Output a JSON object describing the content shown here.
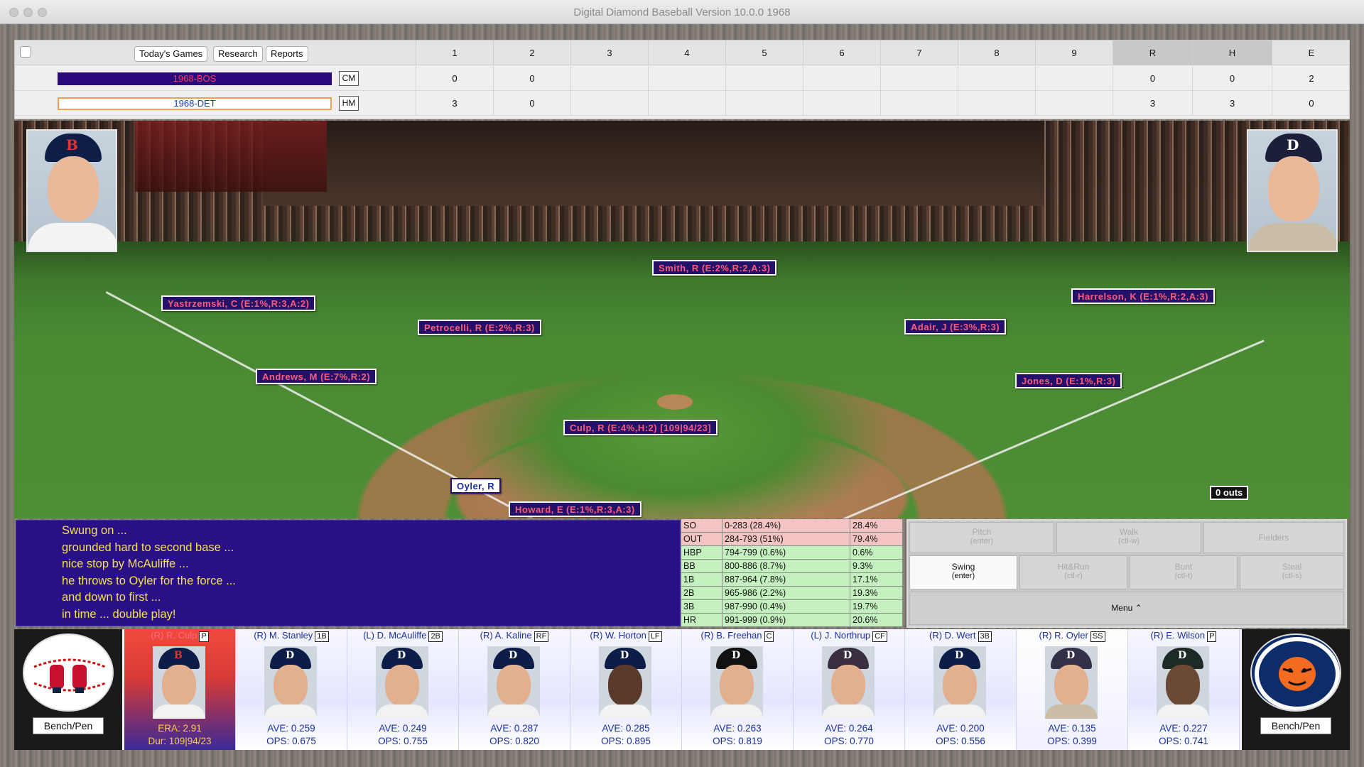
{
  "window": {
    "title": "Digital Diamond Baseball Version 10.0.0 1968"
  },
  "toolbar": {
    "todays_games": "Today's Games",
    "research": "Research",
    "reports": "Reports"
  },
  "scoreboard": {
    "innings": [
      "1",
      "2",
      "3",
      "4",
      "5",
      "6",
      "7",
      "8",
      "9"
    ],
    "totals_headers": [
      "R",
      "H",
      "E"
    ],
    "away": {
      "team": "1968-BOS",
      "side": "CM",
      "innings": [
        "0",
        "0",
        "",
        "",
        "",
        "",
        "",
        "",
        ""
      ],
      "R": "0",
      "H": "0",
      "E": "2",
      "color": "#2a0a7a"
    },
    "home": {
      "team": "1968-DET",
      "side": "HM",
      "innings": [
        "3",
        "0",
        "",
        "",
        "",
        "",
        "",
        "",
        ""
      ],
      "R": "3",
      "H": "3",
      "E": "0"
    }
  },
  "field": {
    "fielders": {
      "cf": "Smith, R (E:2%,R:2,A:3)",
      "lf": "Yastrzemski, C (E:1%,R:3,A:2)",
      "rf": "Harrelson, K (E:1%,R:2,A:3)",
      "ss": "Petrocelli, R (E:2%,R:3)",
      "second": "Adair, J (E:3%,R:3)",
      "third": "Andrews, M (E:7%,R:2)",
      "first": "Jones, D (E:1%,R:3)",
      "pitcher": "Culp, R (E:4%,H:2) [109|94/23]",
      "catcher": "Howard, E (E:1%,R:3,A:3)"
    },
    "batter": "Oyler, R",
    "outs": "0 outs"
  },
  "play_by_play": [
    "Swung on ...",
    "grounded hard to second base ...",
    "nice stop by McAuliffe ...",
    "he throws to Oyler for the force ...",
    "and down to first ...",
    "in time ... double play!"
  ],
  "odds": [
    {
      "label": "SO",
      "range": "0-283 (28.4%)",
      "pct": "28.4%",
      "tone": "red"
    },
    {
      "label": "OUT",
      "range": "284-793 (51%)",
      "pct": "79.4%",
      "tone": "red"
    },
    {
      "label": "HBP",
      "range": "794-799 (0.6%)",
      "pct": "0.6%",
      "tone": "grn"
    },
    {
      "label": "BB",
      "range": "800-886 (8.7%)",
      "pct": "9.3%",
      "tone": "grn"
    },
    {
      "label": "1B",
      "range": "887-964 (7.8%)",
      "pct": "17.1%",
      "tone": "grn"
    },
    {
      "label": "2B",
      "range": "965-986 (2.2%)",
      "pct": "19.3%",
      "tone": "grn"
    },
    {
      "label": "3B",
      "range": "987-990 (0.4%)",
      "pct": "19.7%",
      "tone": "grn"
    },
    {
      "label": "HR",
      "range": "991-999 (0.9%)",
      "pct": "20.6%",
      "tone": "grn"
    }
  ],
  "actions": {
    "pitch": "Pitch",
    "pitch_key": "(enter)",
    "walk": "Walk",
    "walk_key": "(ctl-w)",
    "fielders": "Fielders",
    "swing": "Swing",
    "swing_key": "(enter)",
    "hitrun": "Hit&Run",
    "hitrun_key": "(ctl-r)",
    "bunt": "Bunt",
    "bunt_key": "(ctl-t)",
    "steal": "Steal",
    "steal_key": "(ctl-s)",
    "menu": "Menu ⌃"
  },
  "lineup": {
    "bench_left": "Bench/Pen",
    "bench_right": "Bench/Pen",
    "pitcher": {
      "name": "(R) R. Culp",
      "pos": "P",
      "line1": "ERA: 2.91",
      "line2": "Dur: 109|94/23"
    },
    "batters": [
      {
        "name": "(R) M. Stanley",
        "pos": "1B",
        "ave": "AVE: 0.259",
        "ops": "OPS: 0.675"
      },
      {
        "name": "(L) D. McAuliffe",
        "pos": "2B",
        "ave": "AVE: 0.249",
        "ops": "OPS: 0.755"
      },
      {
        "name": "(R) A. Kaline",
        "pos": "RF",
        "ave": "AVE: 0.287",
        "ops": "OPS: 0.820"
      },
      {
        "name": "(R) W. Horton",
        "pos": "LF",
        "ave": "AVE: 0.285",
        "ops": "OPS: 0.895"
      },
      {
        "name": "(R) B. Freehan",
        "pos": "C",
        "ave": "AVE: 0.263",
        "ops": "OPS: 0.819"
      },
      {
        "name": "(L) J. Northrup",
        "pos": "CF",
        "ave": "AVE: 0.264",
        "ops": "OPS: 0.770"
      },
      {
        "name": "(R) D. Wert",
        "pos": "3B",
        "ave": "AVE: 0.200",
        "ops": "OPS: 0.556"
      },
      {
        "name": "(R) R. Oyler",
        "pos": "SS",
        "ave": "AVE: 0.135",
        "ops": "OPS: 0.399"
      },
      {
        "name": "(R) E. Wilson",
        "pos": "P",
        "ave": "AVE: 0.227",
        "ops": "OPS: 0.741"
      }
    ]
  }
}
